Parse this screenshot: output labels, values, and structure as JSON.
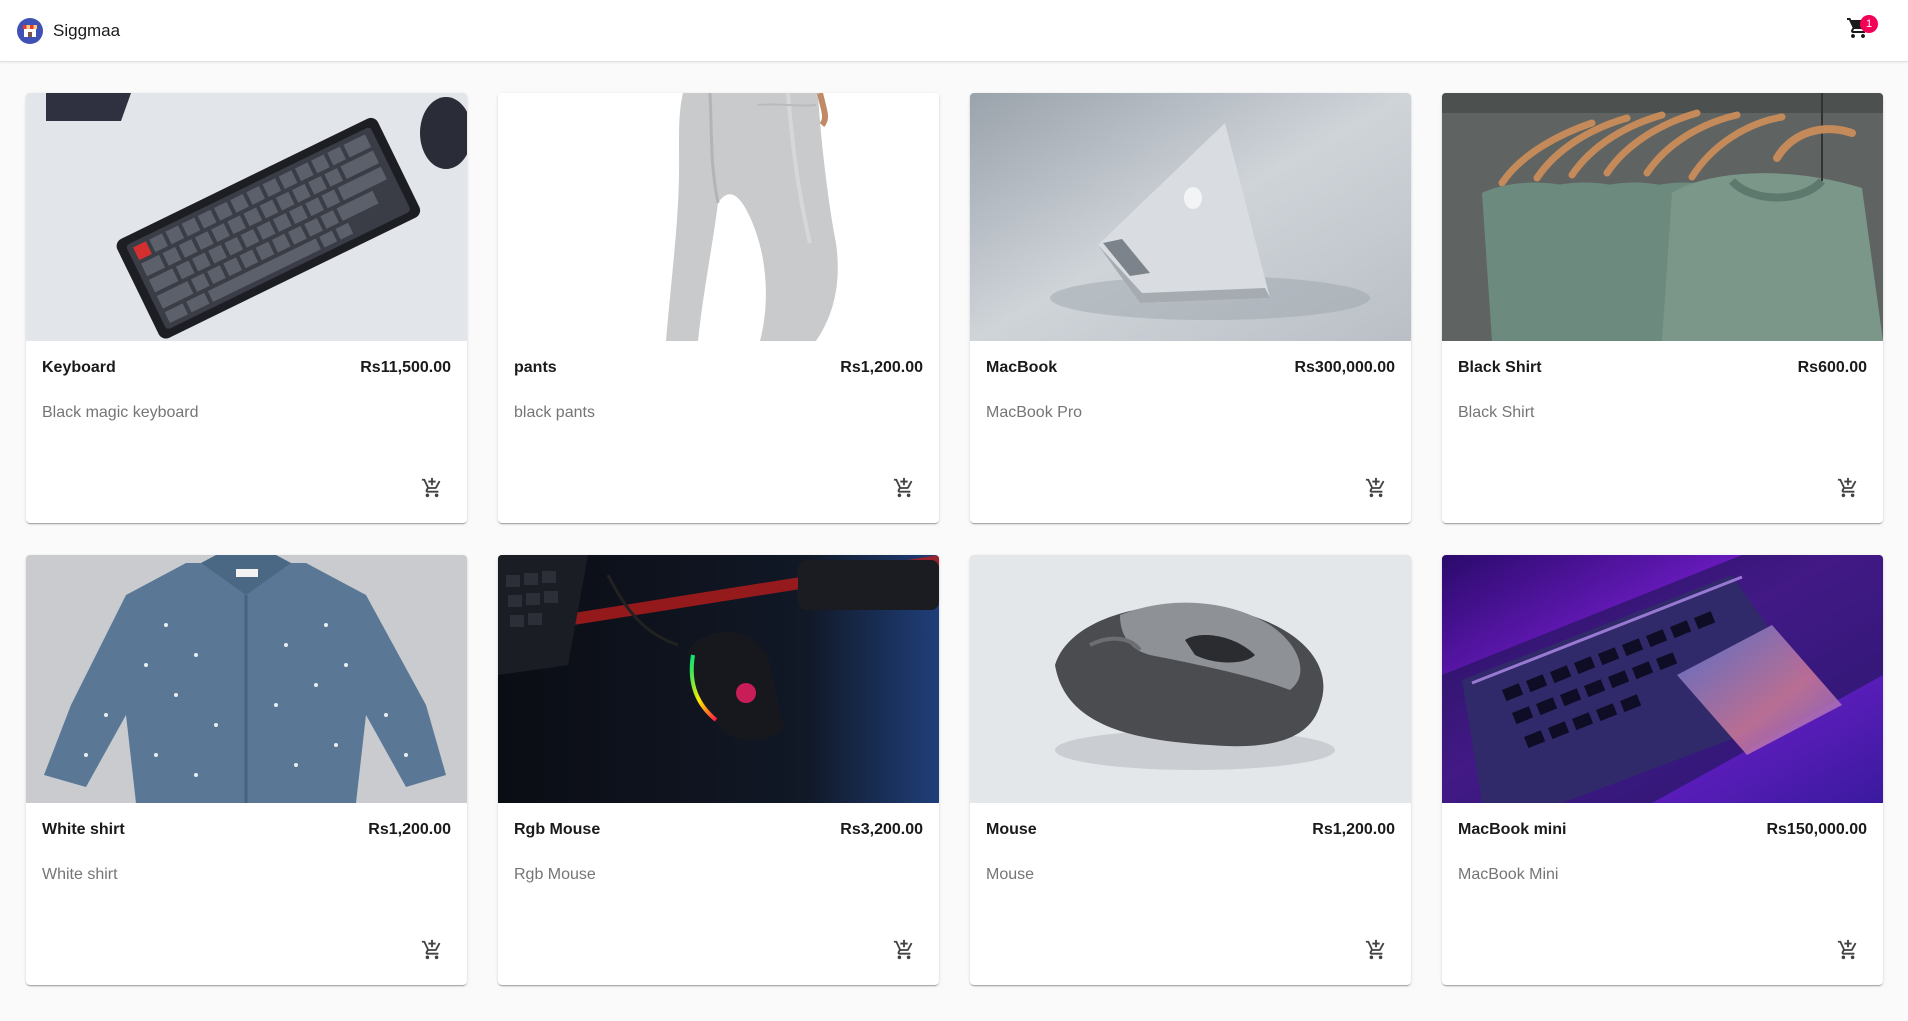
{
  "app": {
    "title": "Siggmaa",
    "cart_count": "1"
  },
  "products": [
    {
      "name": "Keyboard",
      "price": "Rs11,500.00",
      "description": "Black magic keyboard",
      "image": "keyboard"
    },
    {
      "name": "pants",
      "price": "Rs1,200.00",
      "description": "black pants",
      "image": "pants"
    },
    {
      "name": "MacBook",
      "price": "Rs300,000.00",
      "description": "MacBook Pro",
      "image": "macbook"
    },
    {
      "name": "Black Shirt",
      "price": "Rs600.00",
      "description": "Black Shirt",
      "image": "shirts"
    },
    {
      "name": "White shirt",
      "price": "Rs1,200.00",
      "description": "White shirt",
      "image": "denim-shirt"
    },
    {
      "name": "Rgb Mouse",
      "price": "Rs3,200.00",
      "description": "Rgb Mouse",
      "image": "rgb-mouse"
    },
    {
      "name": "Mouse",
      "price": "Rs1,200.00",
      "description": "Mouse",
      "image": "mouse"
    },
    {
      "name": "MacBook mini",
      "price": "Rs150,000.00",
      "description": "MacBook Mini",
      "image": "macbook-neon"
    }
  ],
  "icons": {
    "cart": "shopping-cart-icon",
    "add_to_cart": "add-shopping-cart-icon"
  },
  "colors": {
    "badge": "#f50057",
    "appbar": "#ffffff",
    "background": "#fafafa"
  }
}
